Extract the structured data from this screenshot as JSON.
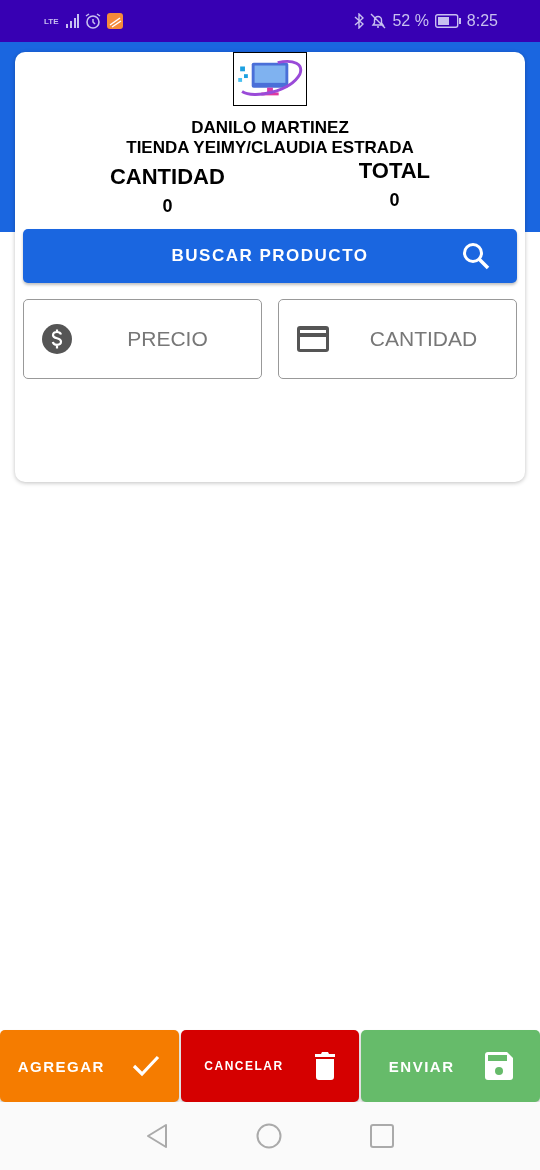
{
  "status_bar": {
    "network": "LTE",
    "battery": "52 %",
    "time": "8:25"
  },
  "header": {
    "name": "DANILO MARTINEZ",
    "store": "TIENDA YEIMY/CLAUDIA ESTRADA"
  },
  "summary": [
    {
      "label": "CANTIDAD",
      "value": "0"
    },
    {
      "label": "TOTAL",
      "value": "0"
    }
  ],
  "search_button": "BUSCAR PRODUCTO",
  "fields": [
    {
      "kind": "money",
      "placeholder": "PRECIO"
    },
    {
      "kind": "card",
      "placeholder": "CANTIDAD"
    }
  ],
  "actions": [
    {
      "kind": "add",
      "label": "AGREGAR"
    },
    {
      "kind": "cancel",
      "label": "CANCELAR"
    },
    {
      "kind": "send",
      "label": "ENVIAR"
    }
  ]
}
